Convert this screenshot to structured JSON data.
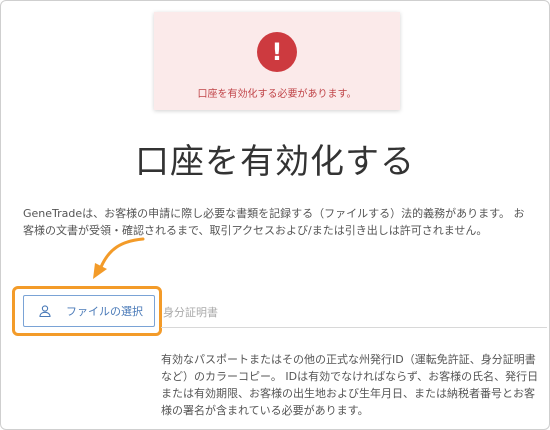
{
  "alert": {
    "icon": "exclamation-icon",
    "icon_glyph": "!",
    "message": "口座を有効化する必要があります。"
  },
  "page": {
    "title": "口座を有効化する",
    "description": "GeneTradeは、お客様の申請に際し必要な書類を記録する（ファイルする）法的義務があります。 お客様の文書が受領・確認されるまで、取引アクセスおよび/または引き出しは許可されません。"
  },
  "upload": {
    "button_label": "ファイルの選択",
    "button_icon": "user-icon",
    "field_placeholder": "身分証明書"
  },
  "requirement_text": "有効なパスポートまたはその他の正式な州発行ID（運転免許証、身分証明書など）のカラーコピー。 IDは有効でなければならず、お客様の氏名、発行日または有効期限、お客様の出生地および生年月日、または納税者番号とお客様の署名が含まれている必要があります。",
  "colors": {
    "alert_bg": "#fbeaea",
    "alert_icon": "#cd3a3f",
    "alert_text": "#c04448",
    "highlight": "#f39b29",
    "button_border": "#7aa3d6",
    "button_text": "#4a7ab8"
  }
}
